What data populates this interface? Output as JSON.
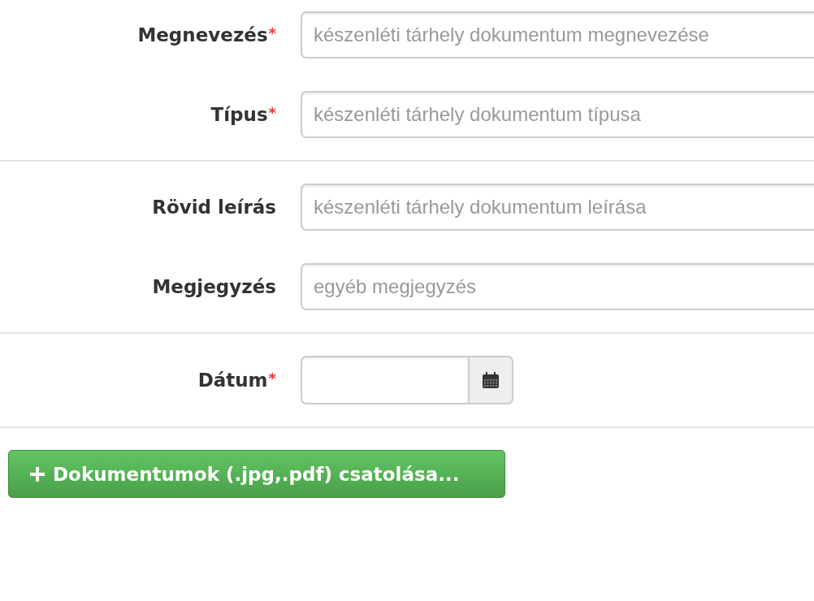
{
  "groups": [
    {
      "fields": [
        {
          "kind": "text",
          "label": "Megnevezés",
          "required_mark": "*",
          "placeholder": "készenléti tárhely dokumentum megnevezése"
        },
        {
          "kind": "text",
          "label": "Típus",
          "required_mark": "*",
          "placeholder": "készenléti tárhely dokumentum típusa"
        }
      ]
    },
    {
      "fields": [
        {
          "kind": "text",
          "label": "Rövid leírás",
          "placeholder": "készenléti tárhely dokumentum leírása"
        },
        {
          "kind": "text",
          "label": "Megjegyzés",
          "placeholder": "egyéb megjegyzés"
        }
      ]
    },
    {
      "fields": [
        {
          "kind": "date",
          "label": "Dátum",
          "required_mark": "*"
        }
      ]
    }
  ],
  "attach_button": {
    "label": "Dokumentumok (.jpg,.pdf) csatolása..."
  }
}
